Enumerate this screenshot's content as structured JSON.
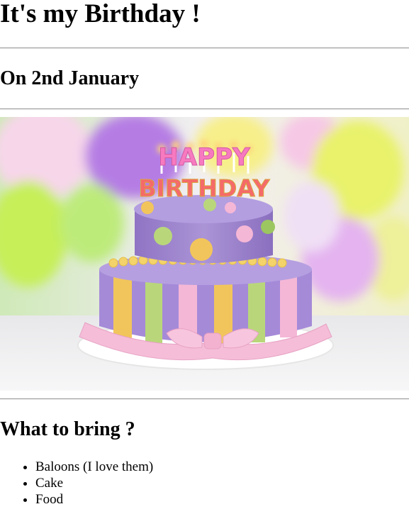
{
  "page": {
    "title": "It's my Birthday !",
    "date_heading": "On 2nd January",
    "bring_heading": "What to bring ?"
  },
  "image": {
    "subject": "birthday cake photo",
    "topper_line1": "HAPPY",
    "topper_line2": "BIRTHDAY"
  },
  "bring_list": [
    "Baloons (I love them)",
    "Cake",
    "Food"
  ],
  "colors": {
    "text": "#000000",
    "rule": "#9a9a9a"
  }
}
